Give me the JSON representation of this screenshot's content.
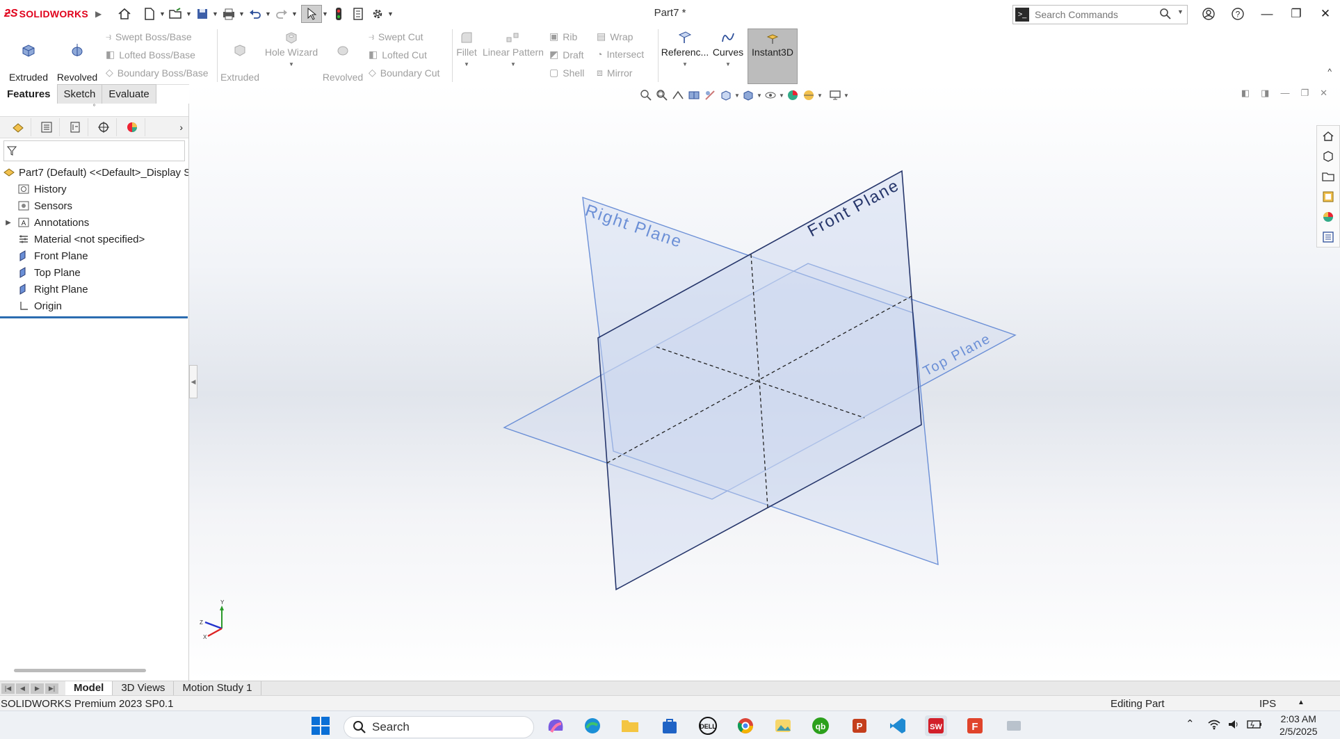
{
  "app": {
    "name": "SOLIDWORKS",
    "document_title": "Part7 *"
  },
  "search_commands": {
    "placeholder": "Search Commands"
  },
  "command_manager": {
    "extruded_boss": "Extruded\nBoss/Base",
    "revolved_boss": "Revolved\nBoss/Base",
    "swept_boss": "Swept Boss/Base",
    "lofted_boss": "Lofted Boss/Base",
    "boundary_boss": "Boundary Boss/Base",
    "extruded_cut": "Extruded\nCut",
    "hole_wizard": "Hole Wizard",
    "revolved_cut": "Revolved\nCut",
    "swept_cut": "Swept Cut",
    "lofted_cut": "Lofted Cut",
    "boundary_cut": "Boundary Cut",
    "fillet": "Fillet",
    "linear_pattern": "Linear Pattern",
    "rib": "Rib",
    "draft": "Draft",
    "shell": "Shell",
    "wrap": "Wrap",
    "intersect": "Intersect",
    "mirror": "Mirror",
    "reference": "Referenc...",
    "curves": "Curves",
    "instant3d": "Instant3D"
  },
  "cm_tabs": [
    "Features",
    "Sketch",
    "Evaluate"
  ],
  "feature_tree": {
    "root": "Part7 (Default) <<Default>_Display S",
    "items": [
      "History",
      "Sensors",
      "Annotations",
      "Material <not specified>",
      "Front Plane",
      "Top Plane",
      "Right Plane",
      "Origin"
    ]
  },
  "viewport": {
    "planes": {
      "right": "Right Plane",
      "front": "Front Plane",
      "top": "Top Plane"
    },
    "triad": {
      "y": "Y",
      "z": "Z",
      "x": "X"
    }
  },
  "bottom_tabs": [
    "Model",
    "3D Views",
    "Motion Study 1"
  ],
  "status_bar": {
    "version": "SOLIDWORKS Premium 2023 SP0.1",
    "mode": "Editing Part",
    "units": "IPS"
  },
  "taskbar": {
    "search_label": "Search",
    "time": "2:03 AM",
    "date": "2/5/2025"
  },
  "colors": {
    "plane_blue": "#6b8fd6",
    "plane_dark": "#26366b",
    "accent_red": "#e0001b"
  }
}
